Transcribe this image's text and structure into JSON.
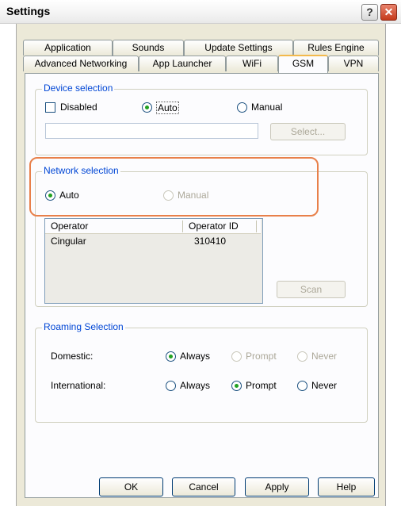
{
  "window": {
    "title": "Settings",
    "help_glyph": "?",
    "close_glyph": "✕"
  },
  "tabs": {
    "row1": [
      "Application",
      "Sounds",
      "Update Settings",
      "Rules Engine"
    ],
    "row2": [
      "Advanced Networking",
      "App Launcher",
      "WiFi",
      "GSM",
      "VPN"
    ],
    "active": "GSM"
  },
  "device_selection": {
    "legend": "Device selection",
    "disabled_label": "Disabled",
    "auto_label": "Auto",
    "manual_label": "Manual",
    "selected": "Auto",
    "device_value": "",
    "select_button": "Select..."
  },
  "network_selection": {
    "legend": "Network selection",
    "auto_label": "Auto",
    "manual_label": "Manual",
    "selected": "Auto",
    "columns": [
      "Operator",
      "Operator ID"
    ],
    "rows": [
      {
        "operator": "Cingular",
        "id": "310410"
      }
    ],
    "scan_button": "Scan"
  },
  "roaming_selection": {
    "legend": "Roaming Selection",
    "domestic_label": "Domestic:",
    "international_label": "International:",
    "options": [
      "Always",
      "Prompt",
      "Never"
    ],
    "domestic_selected": "Always",
    "international_selected": "Prompt"
  },
  "buttons": {
    "ok": "OK",
    "cancel": "Cancel",
    "apply": "Apply",
    "help": "Help"
  },
  "colors": {
    "highlight": "#e8804a",
    "legend_text": "#0046d5",
    "radio_selected": "#21a121",
    "active_tab_accent": "#f3b94c"
  }
}
